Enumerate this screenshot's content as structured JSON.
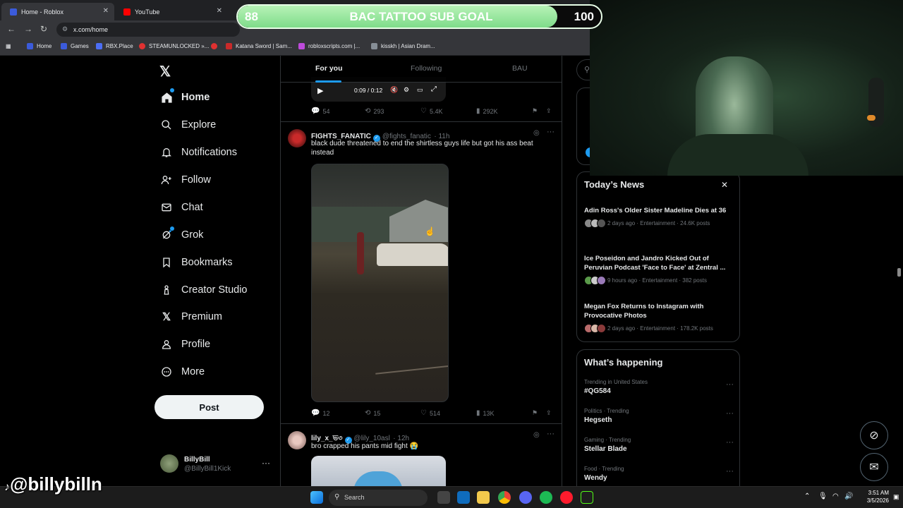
{
  "browser": {
    "tabs": [
      {
        "title": "Home - Roblox",
        "color": "#3b5bdb"
      },
      {
        "title": "YouTube",
        "color": "#ff0000"
      }
    ],
    "url": "x.com/home",
    "bookmarks": [
      {
        "label": "Home",
        "color": "#3b5bdb"
      },
      {
        "label": "Games",
        "color": "#3b5bdb"
      },
      {
        "label": "RBX.Place",
        "color": "#4c6ef5"
      },
      {
        "label": "STEAMUNLOCKED »...",
        "color": "#e03131"
      },
      {
        "label": "Katana Sword | Sam...",
        "color": "#c92a2a"
      },
      {
        "label": "robloxscripts.com |...",
        "color": "#be4bdb"
      },
      {
        "label": "kisskh | Asian Dram...",
        "color": "#868e96"
      }
    ]
  },
  "overlay": {
    "current": "88",
    "title": "BAC TATTOO SUB GOAL",
    "max": "100",
    "progress_fraction": 0.88,
    "watermark": "@billybilln"
  },
  "nav": {
    "items": [
      {
        "label": "Home",
        "icon": "home-icon",
        "glyph": "⌂"
      },
      {
        "label": "Explore",
        "icon": "search-icon",
        "glyph": "⚲"
      },
      {
        "label": "Notifications",
        "icon": "bell-icon",
        "glyph": "🔔"
      },
      {
        "label": "Follow",
        "icon": "follow-icon",
        "glyph": "👤"
      },
      {
        "label": "Chat",
        "icon": "mail-icon",
        "glyph": "✉"
      },
      {
        "label": "Grok",
        "icon": "grok-icon",
        "glyph": "◎"
      },
      {
        "label": "Bookmarks",
        "icon": "bookmark-icon",
        "glyph": "🔖"
      },
      {
        "label": "Creator Studio",
        "icon": "creator-icon",
        "glyph": "♙"
      },
      {
        "label": "Premium",
        "icon": "x-logo-icon",
        "glyph": "𝕏"
      },
      {
        "label": "Profile",
        "icon": "profile-icon",
        "glyph": "👤"
      },
      {
        "label": "More",
        "icon": "more-icon",
        "glyph": "⋯"
      }
    ],
    "post_label": "Post",
    "account": {
      "name": "BillyBill",
      "handle": "@BillyBill1Kick",
      "more": "···"
    }
  },
  "feed": {
    "tabs": [
      "For you",
      "Following",
      "BAU"
    ],
    "video_time": "0:09 / 0:12",
    "tweet0_stats": {
      "replies": "54",
      "reposts": "293",
      "likes": "5.4K",
      "views": "292K"
    },
    "tweets": [
      {
        "name": "FIGHTS_FANATIC",
        "handle": "@fights_fanatic",
        "time": "· 11h",
        "text": "black dude threatened to end the shirtless guys life but got his ass beat instead",
        "stats": {
          "replies": "12",
          "reposts": "15",
          "likes": "514",
          "views": "13K"
        }
      },
      {
        "name": "lily_x_ভ৩",
        "handle": "@lily_10asl",
        "time": "· 12h",
        "text": "bro crapped his pants mid fight 😭"
      }
    ]
  },
  "right": {
    "news_title": "Today’s News",
    "news": [
      {
        "title": "Adin Ross's Older Sister Madeline Dies at 36",
        "meta": "2 days ago · Entertainment · 24.6K posts"
      },
      {
        "title": "Ice Poseidon and Jandro Kicked Out of Peruvian Podcast 'Face to Face' at Zentral ...",
        "meta": "9 hours ago · Entertainment · 382 posts"
      },
      {
        "title": "Megan Fox Returns to Instagram with Provocative Photos",
        "meta": "2 days ago · Entertainment · 178.2K posts"
      }
    ],
    "happening_title": "What’s happening",
    "trends": [
      {
        "context": "Trending in United States",
        "title": "#QG584"
      },
      {
        "context": "Politics · Trending",
        "title": "Hegseth"
      },
      {
        "context": "Gaming · Trending",
        "title": "Stellar Blade"
      },
      {
        "context": "Food · Trending",
        "title": "Wendy"
      }
    ]
  },
  "taskbar": {
    "search_placeholder": "Search",
    "time": "3:51 AM",
    "date": "3/5/2026"
  },
  "colors": {
    "accent": "#1d9bf0",
    "goal_fill": "#9be8a4"
  }
}
